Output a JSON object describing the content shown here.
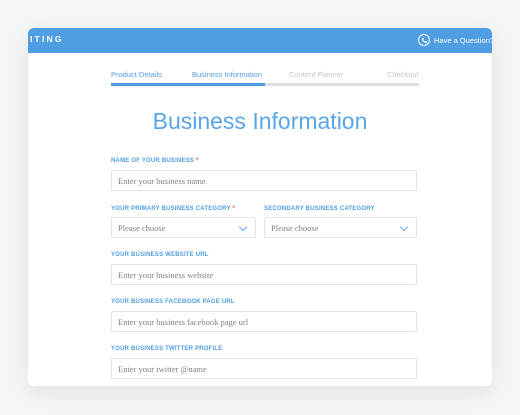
{
  "header": {
    "brand": "ITING",
    "help_text": "Have a Question? (8"
  },
  "steps": [
    {
      "label": "Product Details",
      "state": "done"
    },
    {
      "label": "Business Information",
      "state": "active"
    },
    {
      "label": "Content Planner",
      "state": "todo"
    },
    {
      "label": "Checkout",
      "state": "todo"
    }
  ],
  "progress_fraction": 0.5,
  "page_title": "Business Information",
  "form": {
    "business_name": {
      "label": "NAME OF YOUR BUSINESS",
      "required": "*",
      "placeholder": "Enter your business name"
    },
    "primary_category": {
      "label": "YOUR PRIMARY BUSINESS CATEGORY",
      "required": "*",
      "value": "Please choose"
    },
    "secondary_category": {
      "label": "SECONDARY BUSINESS CATEGORY",
      "value": "Please choose"
    },
    "website": {
      "label": "YOUR BUSINESS WEBSITE URL",
      "placeholder": "Enter your business website"
    },
    "facebook": {
      "label": "YOUR BUSINESS FACEBOOK PAGE URL",
      "placeholder": "Enter your business facebook page url"
    },
    "twitter": {
      "label": "YOUR BUSINESS TWITTER PROFILE",
      "placeholder": "Enter your twitter @name"
    }
  },
  "colors": {
    "accent": "#4f9de3",
    "required": "#e15555",
    "border": "#dfe2e6"
  }
}
